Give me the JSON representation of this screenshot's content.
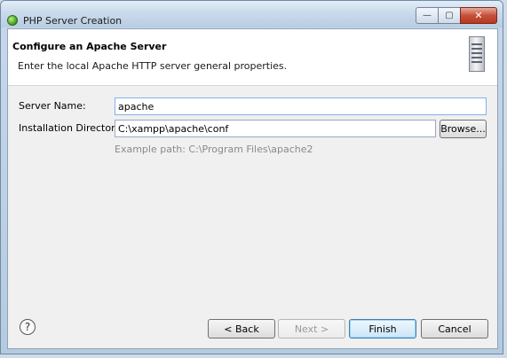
{
  "window": {
    "title": "PHP Server Creation",
    "minimize_glyph": "—",
    "maximize_glyph": "▢",
    "close_glyph": "✕"
  },
  "header": {
    "title": "Configure an Apache Server",
    "description": "Enter the local Apache HTTP server general properties.",
    "icon": "server-icon"
  },
  "form": {
    "server_name": {
      "label": "Server Name:",
      "value": "apache"
    },
    "install_dir": {
      "label": "Installation Directory:",
      "value": "C:\\xampp\\apache\\conf"
    },
    "browse_label": "Browse...",
    "example_path": "Example path: C:\\Program Files\\apache2"
  },
  "footer": {
    "help_glyph": "?",
    "back_label": "< Back",
    "next_label": "Next >",
    "finish_label": "Finish",
    "cancel_label": "Cancel"
  },
  "colors": {
    "accent_focus": "#7eb4ea",
    "close_button": "#c6503a",
    "default_button": "#3c7fb1"
  }
}
